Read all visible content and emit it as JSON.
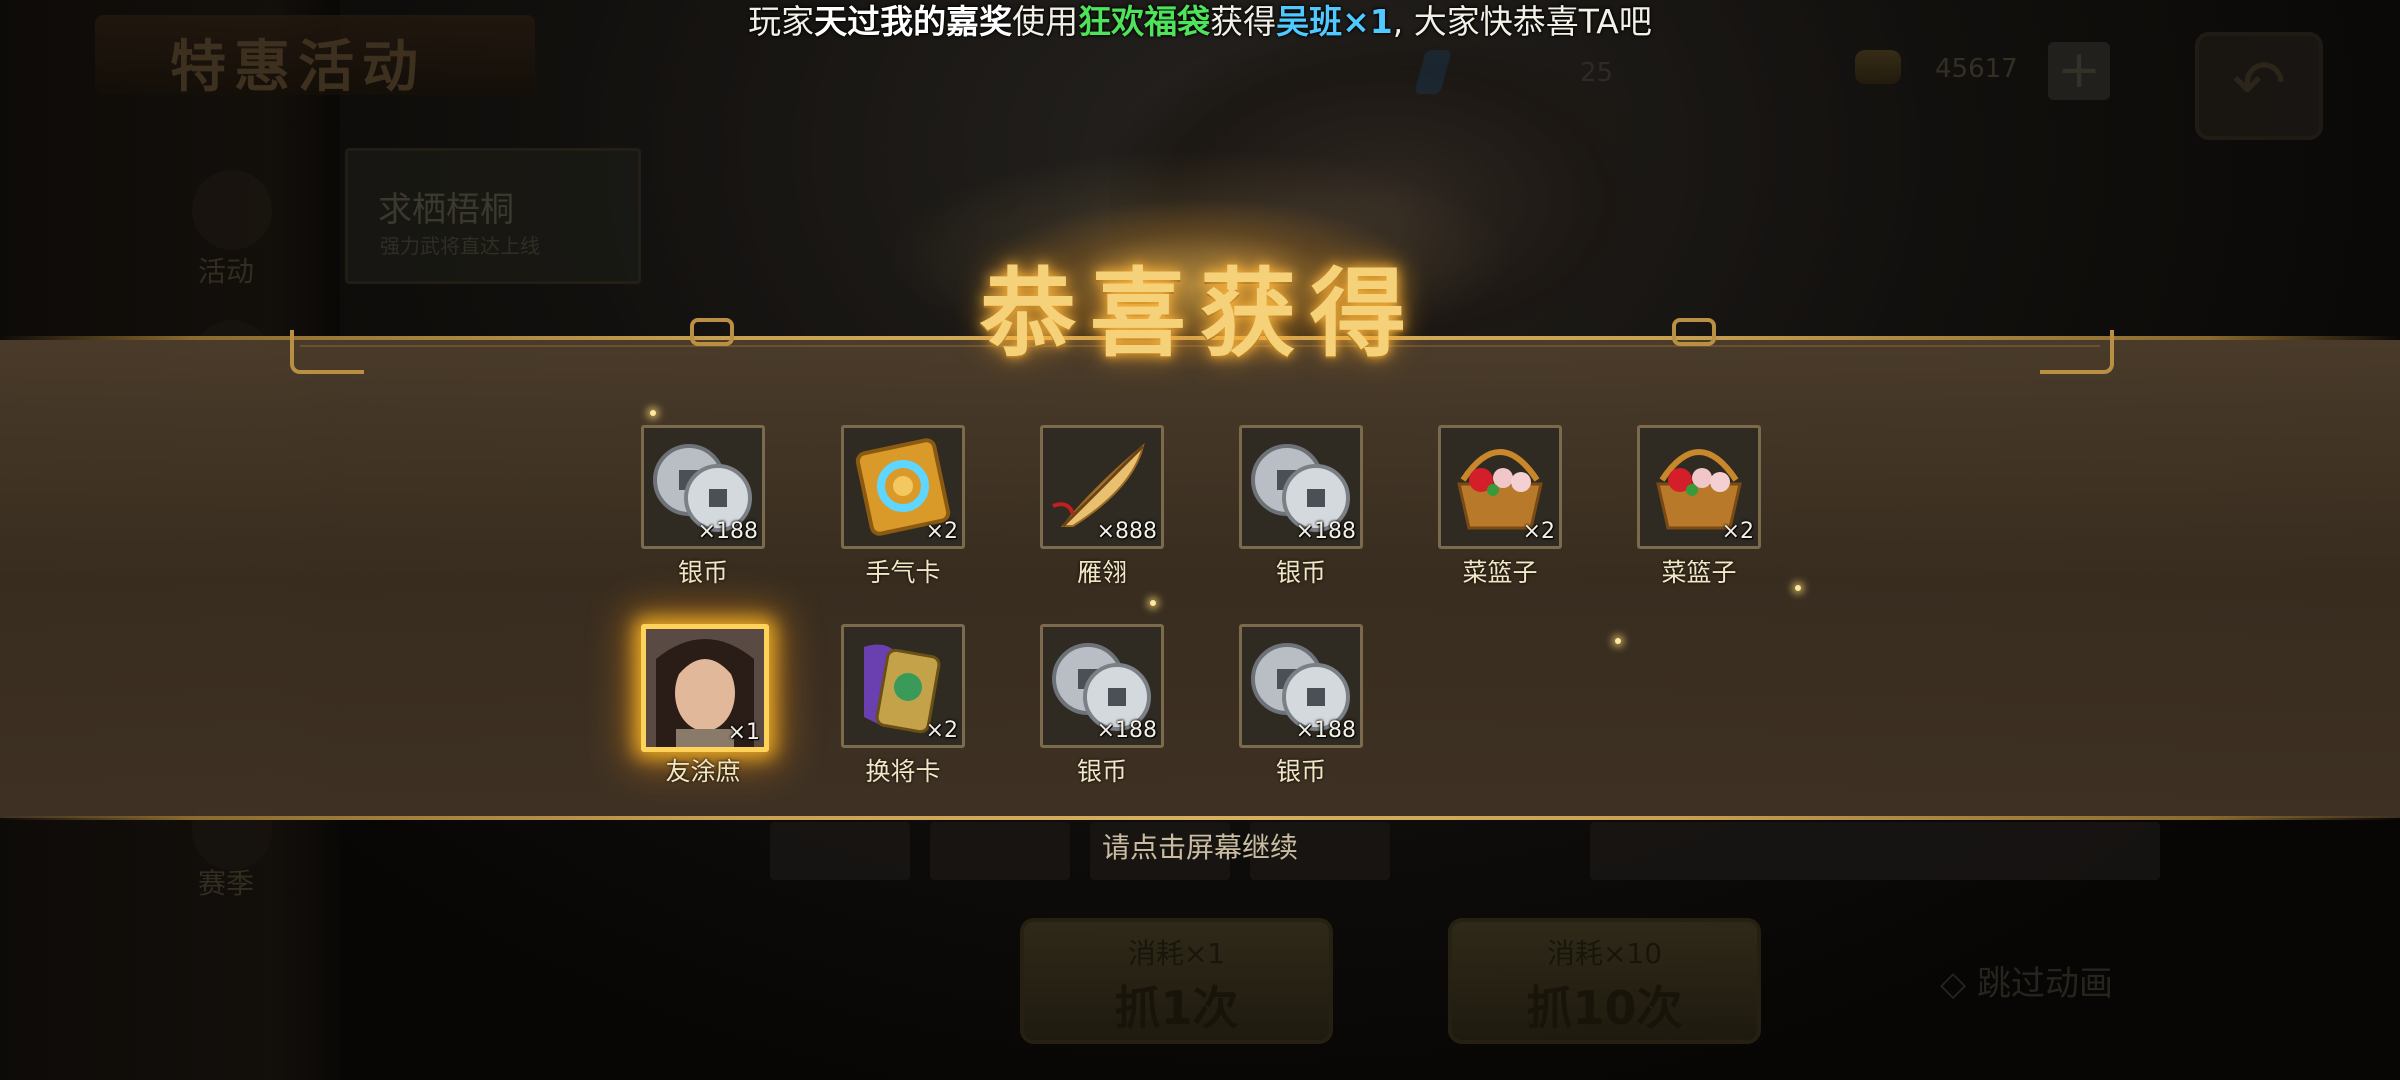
{
  "background": {
    "page_title": "特惠活动",
    "banner_title": "求栖梧桐",
    "banner_subtitle": "强力武将直达上线",
    "side_labels": [
      "活动",
      "赛季"
    ],
    "gold_amount": "45617",
    "count": "25",
    "plus_symbol": "+",
    "back_symbol": "↶",
    "draw_buttons": [
      {
        "cost_label": "消耗",
        "cost_qty": "×1",
        "label": "抓1次"
      },
      {
        "cost_label": "消耗",
        "cost_qty": "×10",
        "label": "抓10次"
      }
    ],
    "skip_animation": "◇ 跳过动画"
  },
  "announcement": {
    "prefix": "玩家",
    "player": "天过我的嘉奖",
    "mid1": "使用",
    "item": "狂欢福袋",
    "mid2": "获得",
    "reward": "吴班×1",
    "suffix": ", 大家快恭喜TA吧"
  },
  "reward_panel": {
    "title": "恭喜获得",
    "continue_hint": "请点击屏幕继续",
    "items": [
      {
        "name": "银币",
        "qty": "×188",
        "icon": "silver-coin-icon"
      },
      {
        "name": "手气卡",
        "qty": "×2",
        "icon": "luck-card-icon"
      },
      {
        "name": "雁翎",
        "qty": "×888",
        "icon": "feather-icon"
      },
      {
        "name": "银币",
        "qty": "×188",
        "icon": "silver-coin-icon"
      },
      {
        "name": "菜篮子",
        "qty": "×2",
        "icon": "basket-icon"
      },
      {
        "name": "菜篮子",
        "qty": "×2",
        "icon": "basket-icon"
      },
      {
        "name": "友涂庶",
        "qty": "×1",
        "icon": "hero-portrait-icon",
        "highlight": true
      },
      {
        "name": "换将卡",
        "qty": "×2",
        "icon": "swap-card-icon"
      },
      {
        "name": "银币",
        "qty": "×188",
        "icon": "silver-coin-icon"
      },
      {
        "name": "银币",
        "qty": "×188",
        "icon": "silver-coin-icon"
      }
    ]
  },
  "colors": {
    "title_gold": "#f5d27a",
    "announce_green": "#4ee35a",
    "announce_blue": "#4fc9ff",
    "highlight_border": "#ffd35a"
  }
}
